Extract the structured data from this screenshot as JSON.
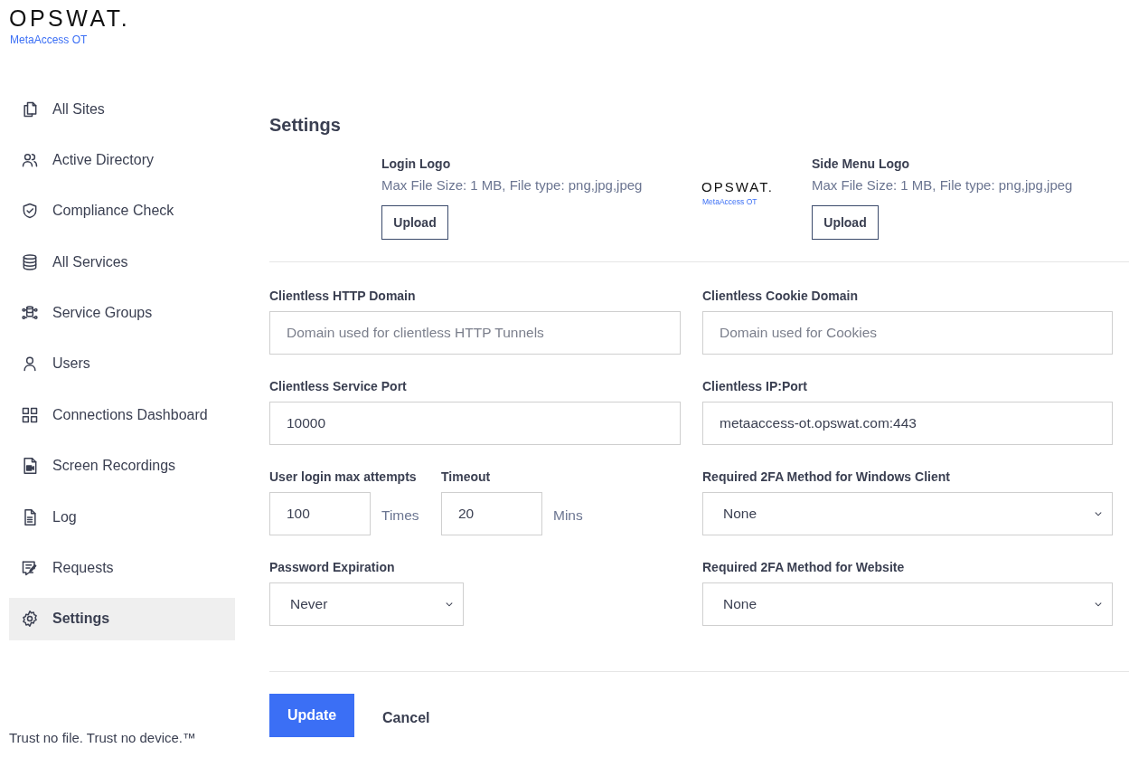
{
  "brand": {
    "logo": "OPSWAT.",
    "product": "MetaAccess OT"
  },
  "sidebar": {
    "items": [
      {
        "label": "All Sites",
        "selected": false
      },
      {
        "label": "Active Directory",
        "selected": false
      },
      {
        "label": "Compliance Check",
        "selected": false
      },
      {
        "label": "All Services",
        "selected": false
      },
      {
        "label": "Service Groups",
        "selected": false
      },
      {
        "label": "Users",
        "selected": false
      },
      {
        "label": "Connections Dashboard",
        "selected": false
      },
      {
        "label": "Screen Recordings",
        "selected": false
      },
      {
        "label": "Log",
        "selected": false
      },
      {
        "label": "Requests",
        "selected": false
      },
      {
        "label": "Settings",
        "selected": true
      }
    ],
    "footer": "Trust no file. Trust no device.™"
  },
  "page": {
    "title": "Settings"
  },
  "logos": {
    "login": {
      "title": "Login Logo",
      "hint": "Max File Size: 1 MB, File type: png,jpg,jpeg",
      "button": "Upload"
    },
    "preview": {
      "logo": "OPSWAT.",
      "product": "MetaAccess OT"
    },
    "side_menu": {
      "title": "Side Menu Logo",
      "hint": "Max File Size: 1 MB, File type: png,jpg,jpeg",
      "button": "Upload"
    }
  },
  "rows": [
    [
      {
        "fields": [
          {
            "kind": "text",
            "label": "Clientless HTTP Domain",
            "placeholder": "Domain used for clientless HTTP Tunnels"
          }
        ]
      },
      {
        "fields": [
          {
            "kind": "text",
            "label": "Clientless Cookie Domain",
            "placeholder": "Domain used for Cookies"
          }
        ]
      }
    ],
    [
      {
        "fields": [
          {
            "kind": "text",
            "label": "Clientless Service Port",
            "value": "10000"
          }
        ]
      },
      {
        "fields": [
          {
            "kind": "text",
            "label": "Clientless IP:Port",
            "value": "metaaccess-ot.opswat.com:443"
          }
        ]
      }
    ],
    [
      {
        "fields": [
          {
            "kind": "short",
            "label": "User login max attempts",
            "value": "100",
            "unit": "Times"
          },
          {
            "kind": "short",
            "label": "Timeout",
            "value": "20",
            "unit": "Mins"
          }
        ]
      },
      {
        "fields": [
          {
            "kind": "select",
            "label": "Required 2FA Method for Windows Client",
            "value": "None"
          }
        ]
      }
    ],
    [
      {
        "fields": [
          {
            "kind": "narrow-select",
            "label": "Password Expiration",
            "value": "Never"
          }
        ]
      },
      {
        "fields": [
          {
            "kind": "select",
            "label": "Required 2FA Method for Website",
            "value": "None"
          }
        ]
      }
    ]
  ],
  "actions": {
    "update": "Update",
    "cancel": "Cancel"
  }
}
